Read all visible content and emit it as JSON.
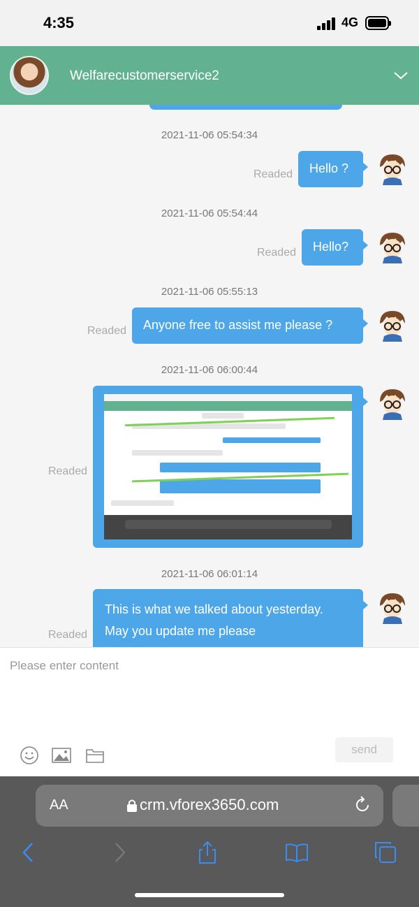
{
  "status_bar": {
    "time": "4:35",
    "network": "4G"
  },
  "header": {
    "agent_name": "Welfarecustomerservice2",
    "expand_icon": "chevron-down-icon"
  },
  "messages": [
    {
      "timestamp": "2021-11-06 05:54:34",
      "text": "Hello ?",
      "status": "Readed"
    },
    {
      "timestamp": "2021-11-06 05:54:44",
      "text": "Hello?",
      "status": "Readed"
    },
    {
      "timestamp": "2021-11-06 05:55:13",
      "text": "Anyone free to assist me please ?",
      "status": "Readed"
    },
    {
      "timestamp": "2021-11-06 06:00:44",
      "type": "image",
      "status": "Readed"
    },
    {
      "timestamp": "2021-11-06 06:01:14",
      "lines": [
        "This is what we talked about yesterday.",
        "May you update me please"
      ],
      "status": "Readed"
    }
  ],
  "composer": {
    "placeholder": "Please enter content",
    "send_label": "send",
    "tools": [
      "emoji-icon",
      "image-icon",
      "folder-icon"
    ]
  },
  "browser": {
    "aa_label": "AA",
    "url": "crm.vforex3650.com",
    "nav": [
      "back-icon",
      "forward-icon",
      "share-icon",
      "bookmarks-icon",
      "tabs-icon"
    ]
  },
  "colors": {
    "header": "#62b291",
    "bubble": "#4da6e8",
    "background": "#f5f5f5"
  }
}
